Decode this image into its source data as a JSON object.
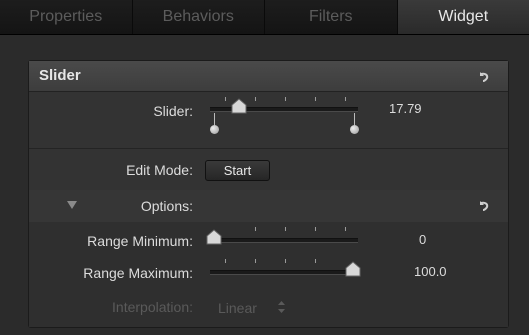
{
  "tabs": [
    {
      "label": "Properties"
    },
    {
      "label": "Behaviors"
    },
    {
      "label": "Filters"
    },
    {
      "label": "Widget"
    }
  ],
  "active_tab": "Widget",
  "section": {
    "title": "Slider"
  },
  "slider": {
    "label": "Slider:",
    "value": "17.79",
    "level": 0.18
  },
  "edit_mode": {
    "label": "Edit Mode:",
    "button_label": "Start"
  },
  "options": {
    "label": "Options:",
    "expanded": true
  },
  "range_min": {
    "label": "Range Minimum:",
    "value": "0",
    "level": 0.0
  },
  "range_max": {
    "label": "Range Maximum:",
    "value": "100.0",
    "level": 1.0
  },
  "interpolation": {
    "label": "Interpolation:",
    "value": "Linear",
    "enabled": false
  },
  "icons": {
    "reset": "reset-arrow-icon",
    "disclosure": "disclosure-triangle-icon",
    "popup": "popup-arrows-icon"
  }
}
